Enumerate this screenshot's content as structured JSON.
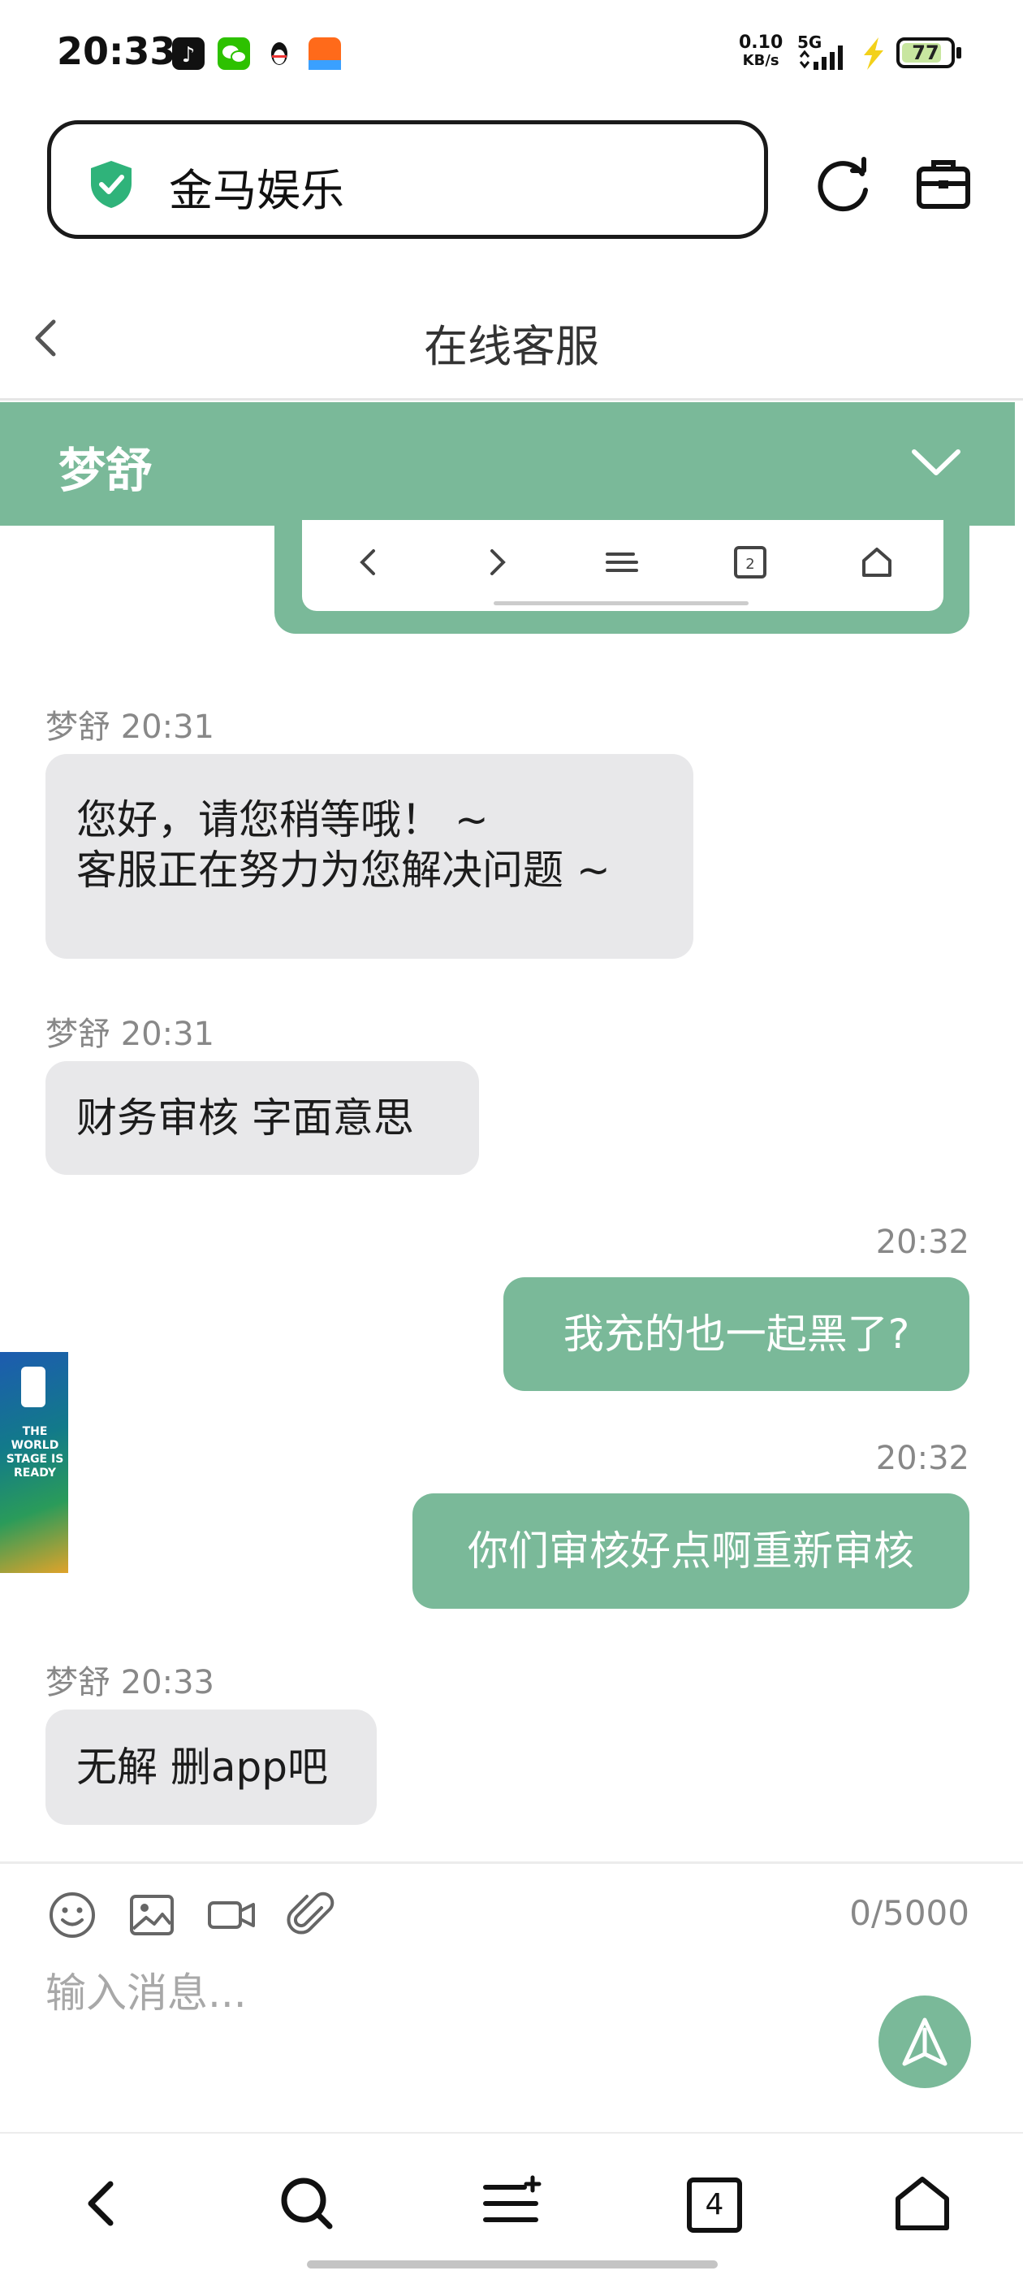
{
  "status_bar": {
    "time": "20:33",
    "net_speed_value": "0.10",
    "net_speed_unit": "KB/s",
    "network": "5G",
    "battery": "77"
  },
  "url_bar": {
    "text": "金马娱乐"
  },
  "header": {
    "title": "在线客服"
  },
  "agent": {
    "name": "梦舒"
  },
  "messages": [
    {
      "side": "in",
      "sender": "梦舒",
      "time": "20:31",
      "meta": "梦舒 20:31",
      "lines": [
        "您好，请您稍等哦！ ~",
        "客服正在努力为您解决问题 ~"
      ]
    },
    {
      "side": "in",
      "sender": "梦舒",
      "time": "20:31",
      "meta": "梦舒 20:31",
      "text": "财务审核 字面意思"
    },
    {
      "side": "out",
      "time": "20:32",
      "text": "我充的也一起黑了?"
    },
    {
      "side": "out",
      "time": "20:32",
      "text": "你们审核好点啊重新审核"
    },
    {
      "side": "in",
      "sender": "梦舒",
      "time": "20:33",
      "meta": "梦舒 20:33",
      "text": "无解 删app吧"
    }
  ],
  "side_ad": {
    "text": "THE WORLD STAGE IS READY"
  },
  "composer": {
    "counter": "0/5000",
    "placeholder": "输入消息..."
  },
  "bottom_nav": {
    "tabs_count": "4"
  },
  "colors": {
    "accent": "#7ab999",
    "incoming_bubble": "#e8e8ea"
  }
}
